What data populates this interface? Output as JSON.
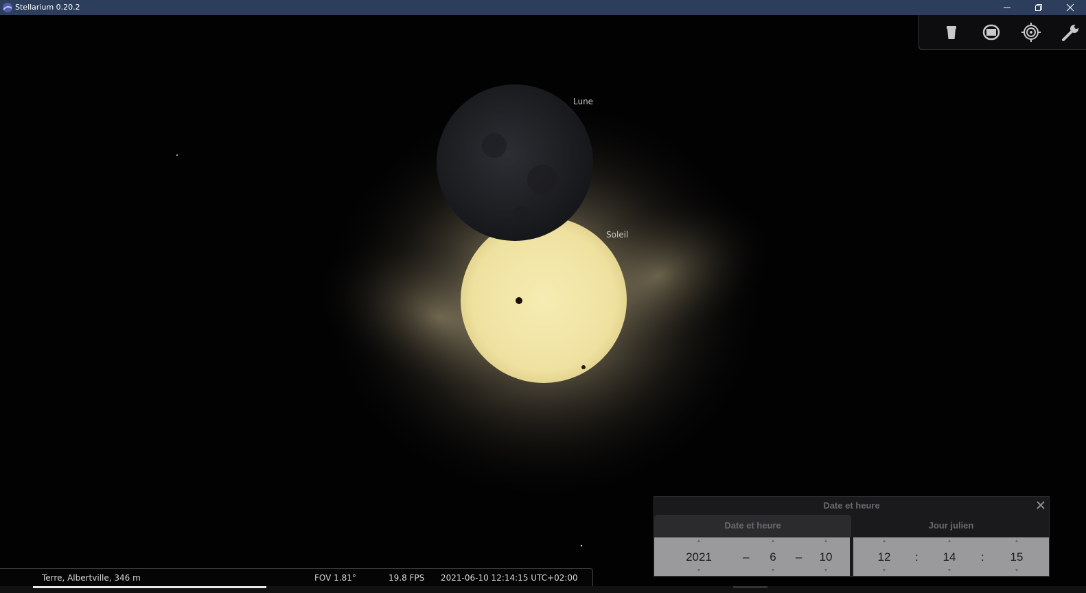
{
  "window": {
    "title": "Stellarium 0.20.2"
  },
  "sky": {
    "labels": {
      "moon": "Lune",
      "sun": "Soleil"
    }
  },
  "statusbar": {
    "location": "Terre, Albertville, 346 m",
    "fov": "FOV 1.81°",
    "fps": "19.8 FPS",
    "datetime": "2021-06-10 12:14:15 UTC+02:00"
  },
  "datetime_dialog": {
    "title": "Date et heure",
    "tabs": [
      {
        "label": "Date et heure",
        "active": true
      },
      {
        "label": "Jour julien",
        "active": false
      }
    ],
    "date": {
      "year": "2021",
      "month": "6",
      "day": "10",
      "separator": "–"
    },
    "time": {
      "hour": "12",
      "minute": "14",
      "second": "15",
      "separator": ":"
    }
  },
  "icons": {
    "topbar": [
      "trash-icon",
      "screen-icon",
      "target-icon",
      "wrench-icon"
    ]
  },
  "colors": {
    "titlebar": "#2c3e5c",
    "sun": "#f2e6a2",
    "corona": "#b8a878",
    "moon": "#222428",
    "panel": "#9a9a9c"
  }
}
